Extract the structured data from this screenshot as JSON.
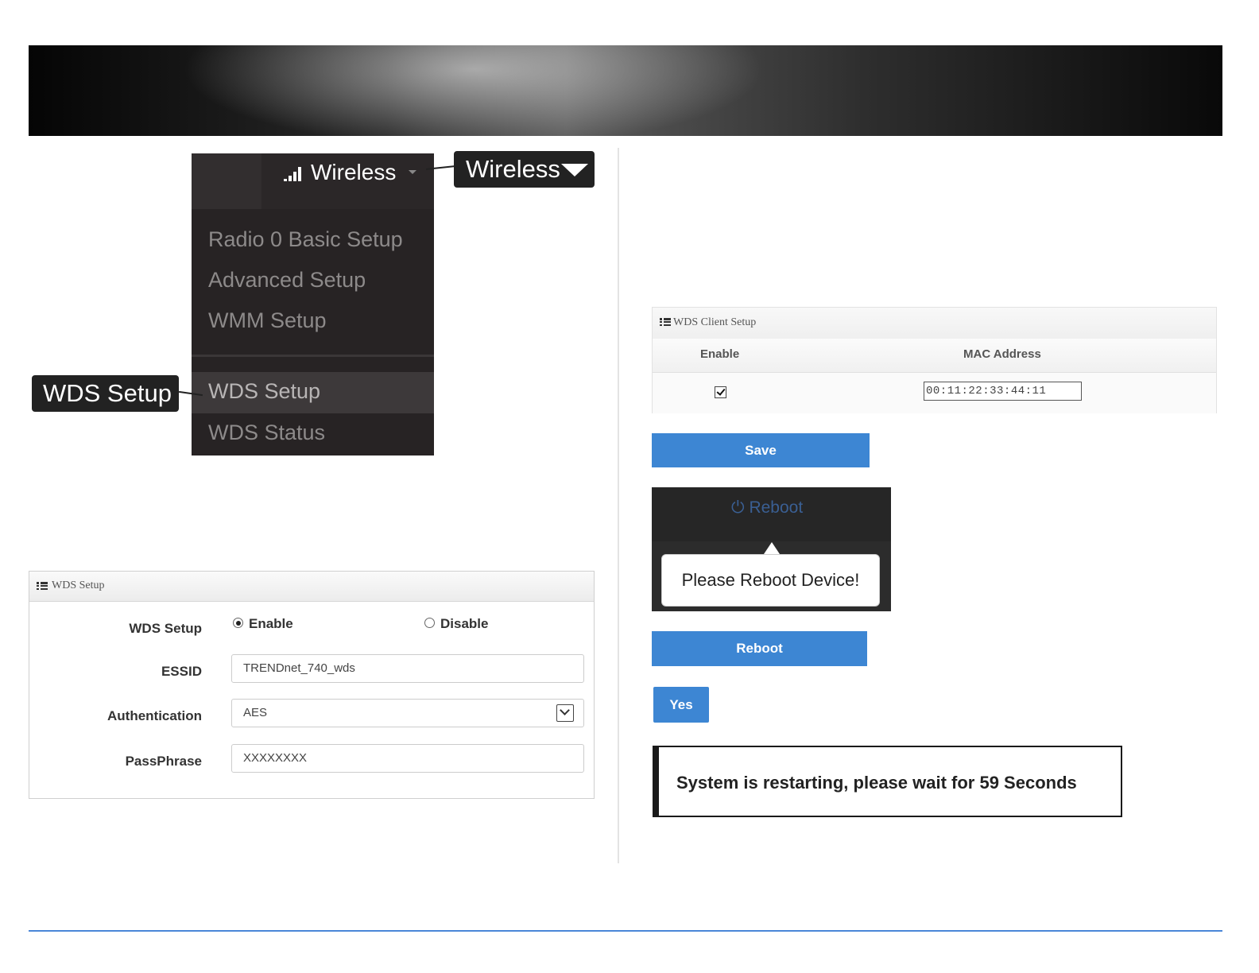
{
  "menu": {
    "title": "Wireless",
    "items": [
      "Radio 0 Basic Setup",
      "Advanced Setup",
      "WMM Setup"
    ],
    "wds_items": [
      "WDS Setup",
      "WDS Status"
    ]
  },
  "callouts": {
    "wireless": "Wireless",
    "wds_setup": "WDS Setup"
  },
  "wds_setup": {
    "title": "WDS Setup",
    "labels": {
      "wds_setup": "WDS Setup",
      "essid": "ESSID",
      "authentication": "Authentication",
      "passphrase": "PassPhrase"
    },
    "radio_enable": "Enable",
    "radio_disable": "Disable",
    "selected": "Enable",
    "essid_value": "TRENDnet_740_wds",
    "auth_value": "AES",
    "passphrase_value": "XXXXXXXX"
  },
  "wds_client": {
    "title": "WDS Client Setup",
    "col_enable": "Enable",
    "col_mac": "MAC Address",
    "enabled": true,
    "mac_value": "00:11:22:33:44:11"
  },
  "buttons": {
    "save": "Save",
    "reboot": "Reboot",
    "yes": "Yes"
  },
  "reboot_prompt": {
    "menu_label": "Reboot",
    "tooltip": "Please Reboot Device!"
  },
  "restart_message": "System is restarting, please wait for 59 Seconds",
  "colors": {
    "accent_blue": "#3d86d3",
    "menu_bg": "#272324",
    "footer_line": "#4a86d8"
  }
}
